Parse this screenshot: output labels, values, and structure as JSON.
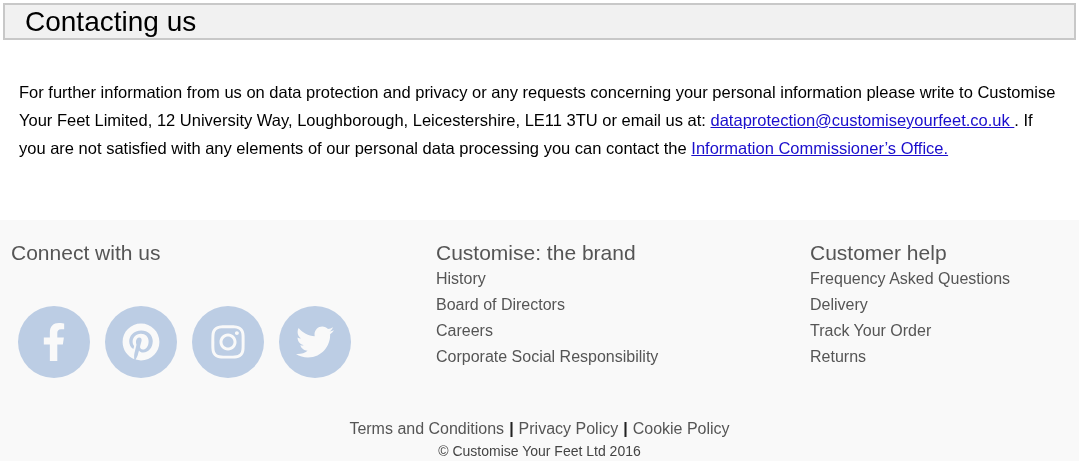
{
  "section": {
    "title": "Contacting us",
    "paragraph": [
      {
        "kind": "text",
        "text": "For further information from us on data protection and privacy or any requests concerning your personal information please write to Customise Your Feet Limited, 12 University Way, Loughborough, Leicestershire, LE11 3TU or email us at: "
      },
      {
        "kind": "link",
        "text": "dataprotection@customiseyourfeet.co.uk "
      },
      {
        "kind": "text",
        "text": ". If you are not satisfied with any elements of our personal data processing you can contact the "
      },
      {
        "kind": "link",
        "text": "Information Commissioner’s Office."
      }
    ]
  },
  "footer": {
    "connect": {
      "title": "Connect with us",
      "social_links": [
        {
          "kind": "facebook"
        },
        {
          "kind": "pinterest"
        },
        {
          "kind": "instagram"
        },
        {
          "kind": "twitter"
        }
      ]
    },
    "columns": [
      {
        "title": "Customise: the brand",
        "links": [
          "History",
          "Board of Directors",
          "Careers",
          "Corporate Social Responsibility"
        ]
      },
      {
        "title": "Customer help",
        "links": [
          "Frequency Asked Questions",
          "Delivery",
          "Track Your Order",
          "Returns"
        ]
      }
    ],
    "legal": [
      {
        "kind": "link",
        "text": "Terms and Conditions"
      },
      {
        "kind": "separator",
        "text": "|"
      },
      {
        "kind": "link",
        "text": "Privacy Policy"
      },
      {
        "kind": "separator",
        "text": "|"
      },
      {
        "kind": "link",
        "text": "Cookie Policy"
      }
    ],
    "copyright": "© Customise Your Feet Ltd 2016"
  }
}
